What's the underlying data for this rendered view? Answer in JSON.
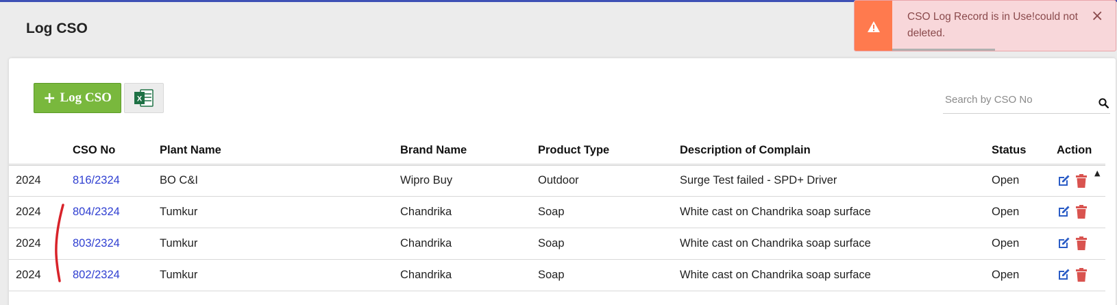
{
  "page": {
    "title": "Log CSO"
  },
  "toolbar": {
    "log_button_label": "Log CSO",
    "excel_icon": "excel-icon"
  },
  "search": {
    "placeholder": "Search by CSO No",
    "value": ""
  },
  "table": {
    "headers": [
      "",
      "CSO No",
      "Plant Name",
      "Brand Name",
      "Product Type",
      "Description of Complain",
      "Status",
      "Action"
    ],
    "rows": [
      {
        "date": "2024",
        "cso": "816/2324",
        "plant": "BO C&I",
        "brand": "Wipro Buy",
        "product": "Outdoor",
        "description": "Surge Test failed - SPD+ Driver",
        "status": "Open"
      },
      {
        "date": "2024",
        "cso": "804/2324",
        "plant": "Tumkur",
        "brand": "Chandrika",
        "product": "Soap",
        "description": "White cast on Chandrika soap surface",
        "status": "Open"
      },
      {
        "date": "2024",
        "cso": "803/2324",
        "plant": "Tumkur",
        "brand": "Chandrika",
        "product": "Soap",
        "description": "White cast on Chandrika soap surface",
        "status": "Open"
      },
      {
        "date": "2024",
        "cso": "802/2324",
        "plant": "Tumkur",
        "brand": "Chandrika",
        "product": "Soap",
        "description": "White cast on Chandrika soap surface",
        "status": "Open"
      }
    ]
  },
  "toast": {
    "message": "CSO Log Record is in Use!could not deleted.",
    "close_label": "×"
  },
  "colors": {
    "accent": "#3f51b5",
    "button_green": "#79b83d",
    "link_blue": "#2f3fd1",
    "edit_blue": "#2a5cc6",
    "delete_red": "#d9534f",
    "toast_bg": "#f8d7da",
    "toast_icon_bg": "#ff7a4e"
  }
}
